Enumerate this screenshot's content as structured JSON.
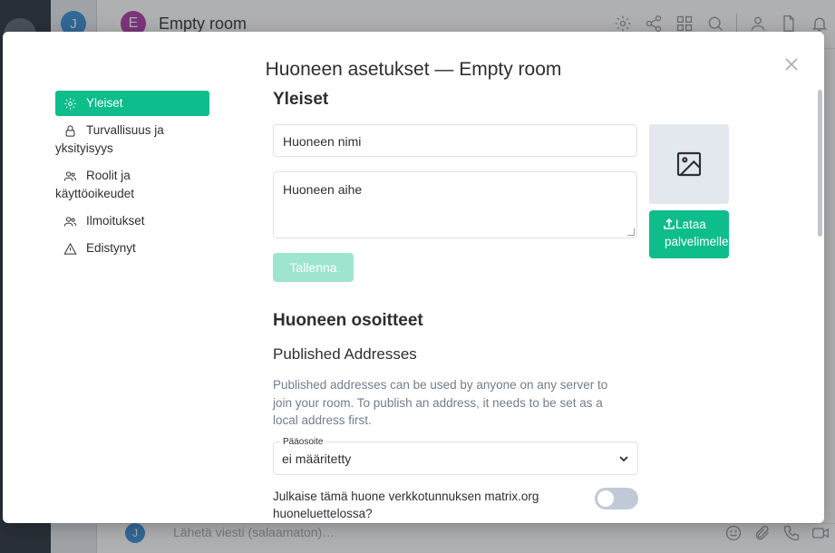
{
  "background": {
    "user_avatar_letter": "J",
    "room_avatar_letter": "E",
    "room_name": "Empty room",
    "header_icons": [
      "settings-icon",
      "share-icon",
      "apps-icon",
      "search-icon",
      "people-icon",
      "files-icon",
      "bell-icon"
    ],
    "composer_avatar_letter": "J",
    "composer_placeholder": "Lähetä viesti (salaamaton)…",
    "composer_icons": [
      "emoji-icon",
      "attachment-icon",
      "voice-call-icon",
      "video-call-icon"
    ]
  },
  "dialog": {
    "title": "Huoneen asetukset — Empty room",
    "close_icon": "close-icon"
  },
  "tabs": [
    {
      "label": "Yleiset",
      "icon": "gear-icon",
      "active": true
    },
    {
      "label_line1": "Turvallisuus ja",
      "label_line2": "yksityisyys",
      "icon": "lock-icon"
    },
    {
      "label_line1": "Roolit ja",
      "label_line2": "käyttöoikeudet",
      "icon": "people-icon"
    },
    {
      "label": "Ilmoitukset",
      "icon": "people-icon"
    },
    {
      "label": "Edistynyt",
      "icon": "warning-icon"
    }
  ],
  "general": {
    "heading": "Yleiset",
    "name_value": "Huoneen nimi",
    "topic_value": "Huoneen aihe",
    "upload_label_line1": "Lataa",
    "upload_label_line2": "palvelimelle",
    "save_label": "Tallenna"
  },
  "addresses": {
    "heading": "Huoneen osoitteet",
    "published_heading": "Published Addresses",
    "description": "Published addresses can be used by anyone on any server to join your room. To publish an address, it needs to be set as a local address first.",
    "main_address_legend": "Pääosoite",
    "main_address_value": "ei määritetty",
    "publish_label": "Julkaise tämä huone verkkotunnuksen matrix.org huoneluettelossa?",
    "publish_enabled": false
  },
  "colors": {
    "accent": "#0dbd8b",
    "accent_disabled": "#9ee5d0",
    "muted_text": "#737d8c"
  }
}
